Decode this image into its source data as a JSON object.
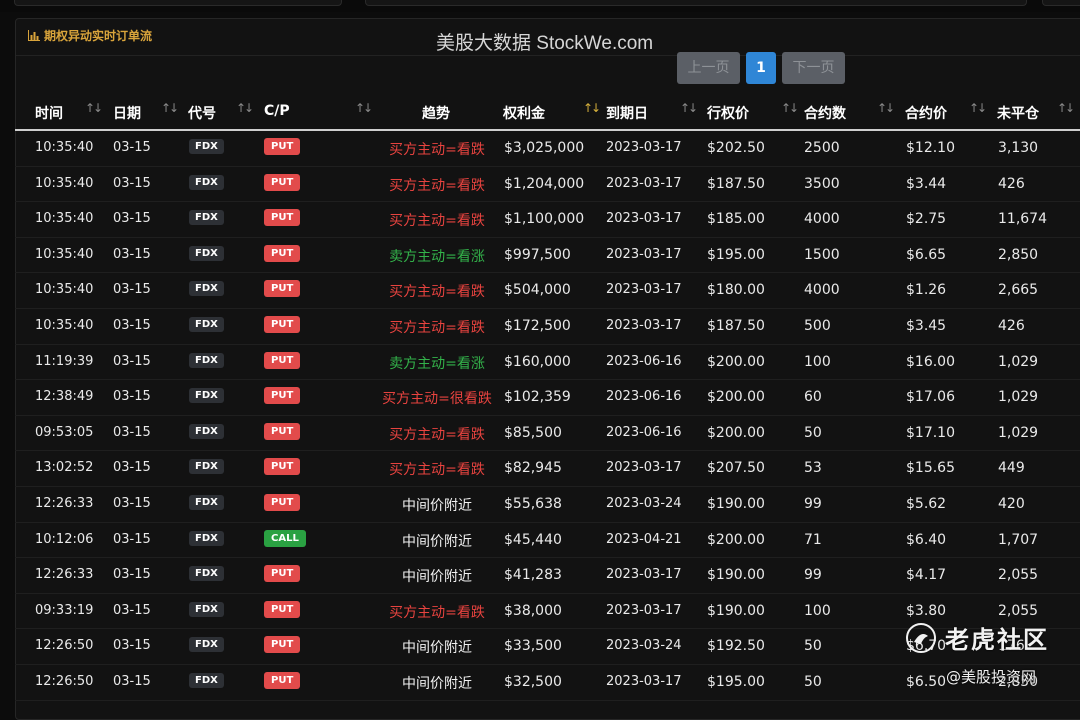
{
  "app": {
    "panel_title": "期权异动实时订单流",
    "watermark_top": "美股大数据 StockWe.com"
  },
  "pager": {
    "prev": "上一页",
    "current": "1",
    "next": "下一页"
  },
  "table": {
    "headers": {
      "time": "时间",
      "date": "日期",
      "symbol": "代号",
      "cp": "C/P",
      "trend": "趋势",
      "premium": "权利金",
      "expiry": "到期日",
      "strike": "行权价",
      "contracts": "合约数",
      "price": "合约价",
      "oi": "未平仓"
    },
    "rows": [
      {
        "time": "10:35:40",
        "date": "03-15",
        "symbol": "FDX",
        "cp": "PUT",
        "trend": "买方主动=看跌",
        "trend_color": "red",
        "premium": "$3,025,000",
        "expiry": "2023-03-17",
        "strike": "$202.50",
        "contracts": "2500",
        "price": "$12.10",
        "oi": "3,130"
      },
      {
        "time": "10:35:40",
        "date": "03-15",
        "symbol": "FDX",
        "cp": "PUT",
        "trend": "买方主动=看跌",
        "trend_color": "red",
        "premium": "$1,204,000",
        "expiry": "2023-03-17",
        "strike": "$187.50",
        "contracts": "3500",
        "price": "$3.44",
        "oi": "426"
      },
      {
        "time": "10:35:40",
        "date": "03-15",
        "symbol": "FDX",
        "cp": "PUT",
        "trend": "买方主动=看跌",
        "trend_color": "red",
        "premium": "$1,100,000",
        "expiry": "2023-03-17",
        "strike": "$185.00",
        "contracts": "4000",
        "price": "$2.75",
        "oi": "11,674"
      },
      {
        "time": "10:35:40",
        "date": "03-15",
        "symbol": "FDX",
        "cp": "PUT",
        "trend": "卖方主动=看涨",
        "trend_color": "green",
        "premium": "$997,500",
        "expiry": "2023-03-17",
        "strike": "$195.00",
        "contracts": "1500",
        "price": "$6.65",
        "oi": "2,850"
      },
      {
        "time": "10:35:40",
        "date": "03-15",
        "symbol": "FDX",
        "cp": "PUT",
        "trend": "买方主动=看跌",
        "trend_color": "red",
        "premium": "$504,000",
        "expiry": "2023-03-17",
        "strike": "$180.00",
        "contracts": "4000",
        "price": "$1.26",
        "oi": "2,665"
      },
      {
        "time": "10:35:40",
        "date": "03-15",
        "symbol": "FDX",
        "cp": "PUT",
        "trend": "买方主动=看跌",
        "trend_color": "red",
        "premium": "$172,500",
        "expiry": "2023-03-17",
        "strike": "$187.50",
        "contracts": "500",
        "price": "$3.45",
        "oi": "426"
      },
      {
        "time": "11:19:39",
        "date": "03-15",
        "symbol": "FDX",
        "cp": "PUT",
        "trend": "卖方主动=看涨",
        "trend_color": "green",
        "premium": "$160,000",
        "expiry": "2023-06-16",
        "strike": "$200.00",
        "contracts": "100",
        "price": "$16.00",
        "oi": "1,029"
      },
      {
        "time": "12:38:49",
        "date": "03-15",
        "symbol": "FDX",
        "cp": "PUT",
        "trend": "买方主动=很看跌",
        "trend_color": "red",
        "premium": "$102,359",
        "expiry": "2023-06-16",
        "strike": "$200.00",
        "contracts": "60",
        "price": "$17.06",
        "oi": "1,029"
      },
      {
        "time": "09:53:05",
        "date": "03-15",
        "symbol": "FDX",
        "cp": "PUT",
        "trend": "买方主动=看跌",
        "trend_color": "red",
        "premium": "$85,500",
        "expiry": "2023-06-16",
        "strike": "$200.00",
        "contracts": "50",
        "price": "$17.10",
        "oi": "1,029"
      },
      {
        "time": "13:02:52",
        "date": "03-15",
        "symbol": "FDX",
        "cp": "PUT",
        "trend": "买方主动=看跌",
        "trend_color": "red",
        "premium": "$82,945",
        "expiry": "2023-03-17",
        "strike": "$207.50",
        "contracts": "53",
        "price": "$15.65",
        "oi": "449"
      },
      {
        "time": "12:26:33",
        "date": "03-15",
        "symbol": "FDX",
        "cp": "PUT",
        "trend": "中间价附近",
        "trend_color": "white",
        "premium": "$55,638",
        "expiry": "2023-03-24",
        "strike": "$190.00",
        "contracts": "99",
        "price": "$5.62",
        "oi": "420"
      },
      {
        "time": "10:12:06",
        "date": "03-15",
        "symbol": "FDX",
        "cp": "CALL",
        "trend": "中间价附近",
        "trend_color": "white",
        "premium": "$45,440",
        "expiry": "2023-04-21",
        "strike": "$200.00",
        "contracts": "71",
        "price": "$6.40",
        "oi": "1,707"
      },
      {
        "time": "12:26:33",
        "date": "03-15",
        "symbol": "FDX",
        "cp": "PUT",
        "trend": "中间价附近",
        "trend_color": "white",
        "premium": "$41,283",
        "expiry": "2023-03-17",
        "strike": "$190.00",
        "contracts": "99",
        "price": "$4.17",
        "oi": "2,055"
      },
      {
        "time": "09:33:19",
        "date": "03-15",
        "symbol": "FDX",
        "cp": "PUT",
        "trend": "买方主动=看跌",
        "trend_color": "red",
        "premium": "$38,000",
        "expiry": "2023-03-17",
        "strike": "$190.00",
        "contracts": "100",
        "price": "$3.80",
        "oi": "2,055"
      },
      {
        "time": "12:26:50",
        "date": "03-15",
        "symbol": "FDX",
        "cp": "PUT",
        "trend": "中间价附近",
        "trend_color": "white",
        "premium": "$33,500",
        "expiry": "2023-03-24",
        "strike": "$192.50",
        "contracts": "50",
        "price": "$6.70",
        "oi": "176"
      },
      {
        "time": "12:26:50",
        "date": "03-15",
        "symbol": "FDX",
        "cp": "PUT",
        "trend": "中间价附近",
        "trend_color": "white",
        "premium": "$32,500",
        "expiry": "2023-03-17",
        "strike": "$195.00",
        "contracts": "50",
        "price": "$6.50",
        "oi": "2,850"
      }
    ]
  },
  "brand": {
    "name": "老虎社区",
    "sub": "@美股投资网"
  },
  "colors": {
    "red": "#e7433f",
    "green": "#33b24a",
    "accent": "#2f86d6",
    "gold": "#d9a43b"
  }
}
